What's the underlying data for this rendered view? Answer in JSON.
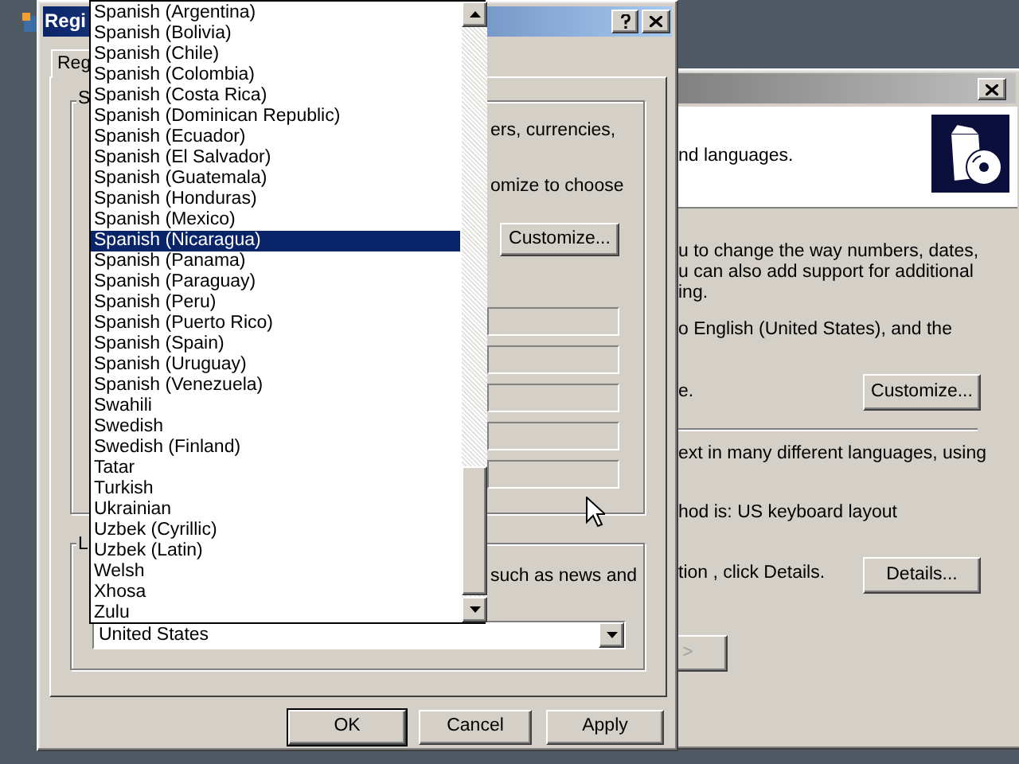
{
  "back_window": {
    "header_text": "nd languages.",
    "lines": [
      "u to change the way numbers, dates,",
      "u can also add support for additional",
      "ing.",
      "o English (United States), and the",
      "e.",
      "ext in many different languages, using",
      "hod is: US keyboard layout",
      "tion , click Details."
    ],
    "buttons": [
      {
        "label": "Customize...",
        "disabled": false
      },
      {
        "label": "Details...",
        "disabled": false
      },
      {
        "label": ">",
        "disabled": true
      }
    ]
  },
  "dialog": {
    "title": "Regi",
    "tabs": [
      {
        "label": "Reg",
        "selected": true
      }
    ],
    "formats_group": {
      "label": "S",
      "lines": [
        "ers, currencies,",
        "omize to choose"
      ],
      "customize_button": "Customize...",
      "sample_fields": [
        {
          "disabled": true
        },
        {
          "disabled": true
        },
        {
          "disabled": true
        },
        {
          "disabled": true
        },
        {
          "disabled": true
        }
      ]
    },
    "location_group": {
      "label": "L",
      "text": "such as news and",
      "value": "United States"
    },
    "buttons": [
      {
        "label": "OK",
        "default": true
      },
      {
        "label": "Cancel",
        "default": false
      },
      {
        "label": "Apply",
        "default": false
      }
    ],
    "dropdown": {
      "items": [
        {
          "label": "Spanish (Argentina)",
          "selected": false
        },
        {
          "label": "Spanish (Bolivia)",
          "selected": false
        },
        {
          "label": "Spanish (Chile)",
          "selected": false
        },
        {
          "label": "Spanish (Colombia)",
          "selected": false
        },
        {
          "label": "Spanish (Costa Rica)",
          "selected": false
        },
        {
          "label": "Spanish (Dominican Republic)",
          "selected": false
        },
        {
          "label": "Spanish (Ecuador)",
          "selected": false
        },
        {
          "label": "Spanish (El Salvador)",
          "selected": false
        },
        {
          "label": "Spanish (Guatemala)",
          "selected": false
        },
        {
          "label": "Spanish (Honduras)",
          "selected": false
        },
        {
          "label": "Spanish (Mexico)",
          "selected": false
        },
        {
          "label": "Spanish (Nicaragua)",
          "selected": true
        },
        {
          "label": "Spanish (Panama)",
          "selected": false
        },
        {
          "label": "Spanish (Paraguay)",
          "selected": false
        },
        {
          "label": "Spanish (Peru)",
          "selected": false
        },
        {
          "label": "Spanish (Puerto Rico)",
          "selected": false
        },
        {
          "label": "Spanish (Spain)",
          "selected": false
        },
        {
          "label": "Spanish (Uruguay)",
          "selected": false
        },
        {
          "label": "Spanish (Venezuela)",
          "selected": false
        },
        {
          "label": "Swahili",
          "selected": false
        },
        {
          "label": "Swedish",
          "selected": false
        },
        {
          "label": "Swedish (Finland)",
          "selected": false
        },
        {
          "label": "Tatar",
          "selected": false
        },
        {
          "label": "Turkish",
          "selected": false
        },
        {
          "label": "Ukrainian",
          "selected": false
        },
        {
          "label": "Uzbek (Cyrillic)",
          "selected": false
        },
        {
          "label": "Uzbek (Latin)",
          "selected": false
        },
        {
          "label": "Welsh",
          "selected": false
        },
        {
          "label": "Xhosa",
          "selected": false
        },
        {
          "label": "Zulu",
          "selected": false
        }
      ]
    }
  }
}
